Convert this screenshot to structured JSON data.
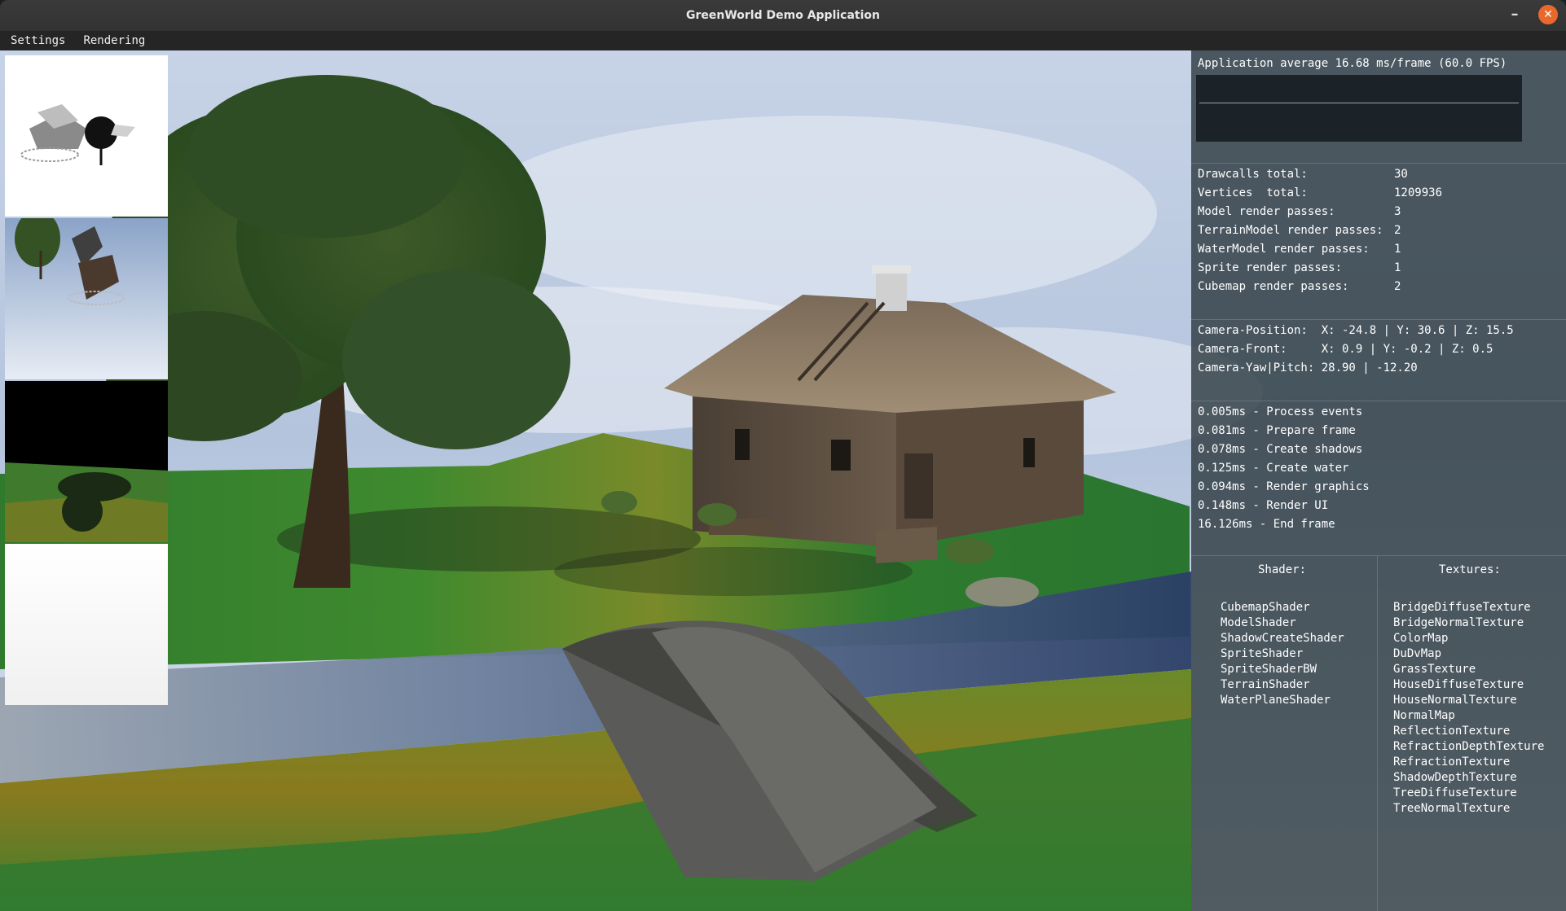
{
  "window": {
    "title": "GreenWorld Demo Application",
    "minimize_glyph": "–",
    "close_glyph": "✕"
  },
  "menu": {
    "items": [
      "Settings",
      "Rendering"
    ]
  },
  "thumbnails": [
    {
      "name": "shadow-map-view"
    },
    {
      "name": "reflection-view"
    },
    {
      "name": "refraction-view"
    },
    {
      "name": "depth-view"
    }
  ],
  "stats": {
    "fps_line": "Application average 16.68 ms/frame (60.0 FPS)",
    "counters": [
      {
        "label": "Drawcalls total:",
        "value": "30"
      },
      {
        "label": "Vertices  total:",
        "value": "1209936"
      },
      {
        "label": "Model render passes:",
        "value": "3"
      },
      {
        "label": "TerrainModel render passes:",
        "value": "2"
      },
      {
        "label": "WaterModel render passes:",
        "value": "1"
      },
      {
        "label": "Sprite render passes:",
        "value": "1"
      },
      {
        "label": "Cubemap render passes:",
        "value": "2"
      }
    ],
    "camera": [
      "Camera-Position:  X: -24.8 | Y: 30.6 | Z: 15.5",
      "Camera-Front:     X: 0.9 | Y: -0.2 | Z: 0.5",
      "Camera-Yaw|Pitch: 28.90 | -12.20"
    ],
    "timings": [
      "0.005ms - Process events",
      "0.081ms - Prepare frame",
      "0.078ms - Create shadows",
      "0.125ms - Create water",
      "0.094ms - Render graphics",
      "0.148ms - Render UI",
      "16.126ms - End frame"
    ]
  },
  "resources": {
    "shader_header": "Shader:",
    "texture_header": "Textures:",
    "shaders": [
      "CubemapShader",
      "ModelShader",
      "ShadowCreateShader",
      "SpriteShader",
      "SpriteShaderBW",
      "TerrainShader",
      "WaterPlaneShader"
    ],
    "textures": [
      "BridgeDiffuseTexture",
      "BridgeNormalTexture",
      "ColorMap",
      "DuDvMap",
      "GrassTexture",
      "HouseDiffuseTexture",
      "HouseNormalTexture",
      "NormalMap",
      "ReflectionTexture",
      "RefractionDepthTexture",
      "RefractionTexture",
      "ShadowDepthTexture",
      "TreeDiffuseTexture",
      "TreeNormalTexture"
    ]
  }
}
